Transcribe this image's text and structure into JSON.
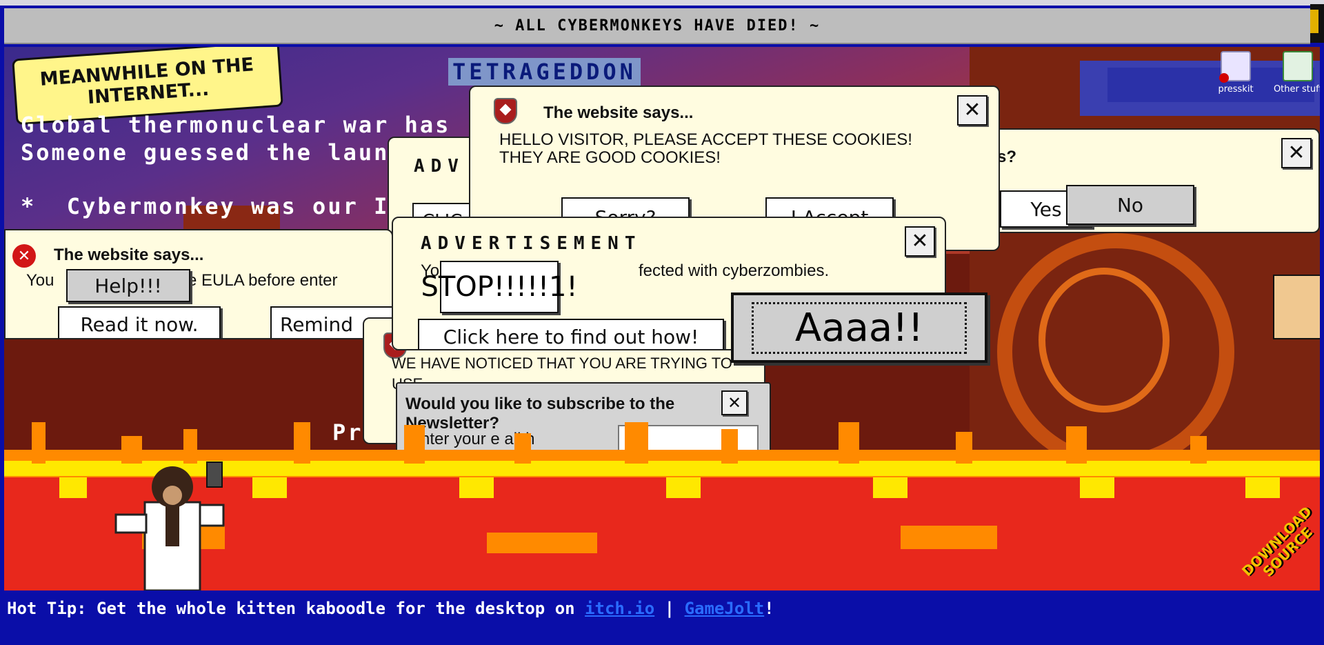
{
  "window": {
    "title": "~ ALL CYBERMONKEYS HAVE DIED! ~"
  },
  "caption": {
    "meanwhile": "MEANWHILE ON THE INTERNET..."
  },
  "game": {
    "logo": "TETRAGEDDON"
  },
  "news": {
    "line1": "Global thermonuclear war has",
    "line2": "Someone guessed the laun",
    "line3": "*  Cybermonkey was our I"
  },
  "desktop_icons": [
    {
      "label": "presskit",
      "icon": "folder-icon"
    },
    {
      "label": "Other stuff",
      "icon": "recycle-bin-icon"
    }
  ],
  "dialogs": {
    "cookies": {
      "title": "The website says...",
      "text_line1": "HELLO VISITOR, PLEASE ACCEPT THESE COOKIES!",
      "text_line2": "THEY ARE GOOD COOKIES!",
      "sorry_label": "Sorry?",
      "accept_label": "I Accept"
    },
    "confirm": {
      "title_fragment": "s?",
      "yes_label": "Yes",
      "no_label": "No"
    },
    "adv_back": {
      "title": "ADV",
      "button_fragment": "CLIC"
    },
    "eula": {
      "title": "The website says...",
      "text_start": "You",
      "text_end": "d the EULA before enter",
      "help_label": "Help!!!",
      "read_label": "Read it now.",
      "remind_label": "Remind"
    },
    "advert": {
      "title": "ADVERTISEMENT",
      "text_start": "Yo",
      "text_end": "fected with cyberzombies.",
      "stop_label": "STOP!!!!!1!",
      "click_label": "Click here to find out how!",
      "aaaa_label": "Aaaa!!"
    },
    "noticed": {
      "text": "WE HAVE NOTICED THAT YOU ARE TRYING TO USE"
    },
    "newsletter": {
      "title": "Would you like to subscribe to the Newsletter?",
      "field_label": "nter your e ail h"
    }
  },
  "footer": {
    "prefix": "Hot Tip: Get the whole kitten kaboodle for the desktop on ",
    "link1": "itch.io",
    "separator": " | ",
    "link2": "GameJolt",
    "suffix": "!"
  },
  "download": {
    "label": "DOWNLOAD SOURCE"
  },
  "scene_fragment": "Pr",
  "colors": {
    "background": "#0a0ea8",
    "dialog": "#fffce0",
    "flame_red": "#e8281c",
    "flame_orange": "#ff8a00",
    "flame_yellow": "#ffe800"
  }
}
